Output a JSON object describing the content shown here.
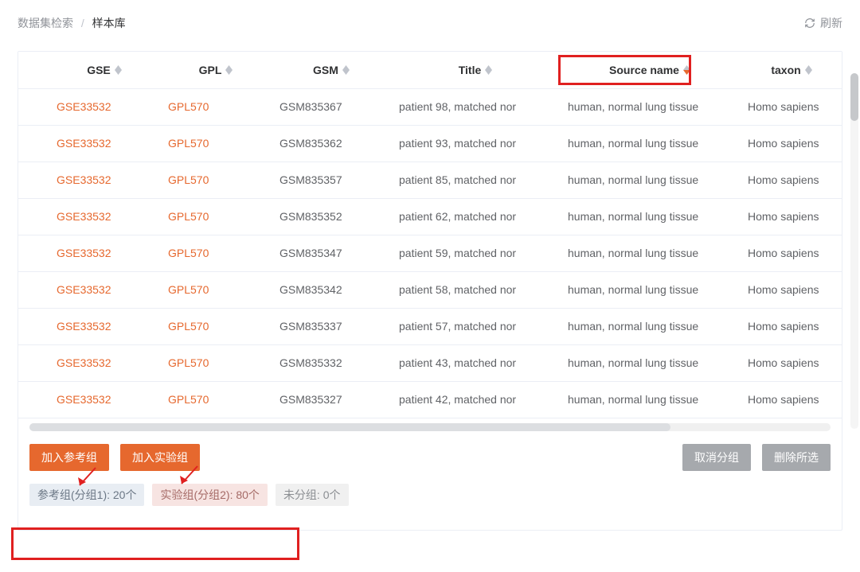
{
  "breadcrumb": {
    "parent": "数据集检索",
    "current": "样本库"
  },
  "refresh_label": "刷新",
  "columns": {
    "gse": "GSE",
    "gpl": "GPL",
    "gsm": "GSM",
    "title": "Title",
    "source": "Source name",
    "taxon": "taxon"
  },
  "sorted_column": "source",
  "sort_direction": "desc",
  "rows": [
    {
      "gse": "GSE33532",
      "gpl": "GPL570",
      "gsm": "GSM835367",
      "title": "patient 98, matched nor",
      "source": "human, normal lung tissue",
      "taxon": "Homo sapiens"
    },
    {
      "gse": "GSE33532",
      "gpl": "GPL570",
      "gsm": "GSM835362",
      "title": "patient 93, matched nor",
      "source": "human, normal lung tissue",
      "taxon": "Homo sapiens"
    },
    {
      "gse": "GSE33532",
      "gpl": "GPL570",
      "gsm": "GSM835357",
      "title": "patient 85, matched nor",
      "source": "human, normal lung tissue",
      "taxon": "Homo sapiens"
    },
    {
      "gse": "GSE33532",
      "gpl": "GPL570",
      "gsm": "GSM835352",
      "title": "patient 62, matched nor",
      "source": "human, normal lung tissue",
      "taxon": "Homo sapiens"
    },
    {
      "gse": "GSE33532",
      "gpl": "GPL570",
      "gsm": "GSM835347",
      "title": "patient 59, matched nor",
      "source": "human, normal lung tissue",
      "taxon": "Homo sapiens"
    },
    {
      "gse": "GSE33532",
      "gpl": "GPL570",
      "gsm": "GSM835342",
      "title": "patient 58, matched nor",
      "source": "human, normal lung tissue",
      "taxon": "Homo sapiens"
    },
    {
      "gse": "GSE33532",
      "gpl": "GPL570",
      "gsm": "GSM835337",
      "title": "patient 57, matched nor",
      "source": "human, normal lung tissue",
      "taxon": "Homo sapiens"
    },
    {
      "gse": "GSE33532",
      "gpl": "GPL570",
      "gsm": "GSM835332",
      "title": "patient 43, matched nor",
      "source": "human, normal lung tissue",
      "taxon": "Homo sapiens"
    },
    {
      "gse": "GSE33532",
      "gpl": "GPL570",
      "gsm": "GSM835327",
      "title": "patient 42, matched nor",
      "source": "human, normal lung tissue",
      "taxon": "Homo sapiens"
    }
  ],
  "actions": {
    "add_ref": "加入参考组",
    "add_exp": "加入实验组",
    "cancel_group": "取消分组",
    "delete_selected": "删除所选"
  },
  "badges": {
    "ref": "参考组(分组1): 20个",
    "exp": "实验组(分组2): 80个",
    "unassigned": "未分组: 0个"
  },
  "colors": {
    "primary": "#e6682e",
    "annotation": "#e02020"
  }
}
